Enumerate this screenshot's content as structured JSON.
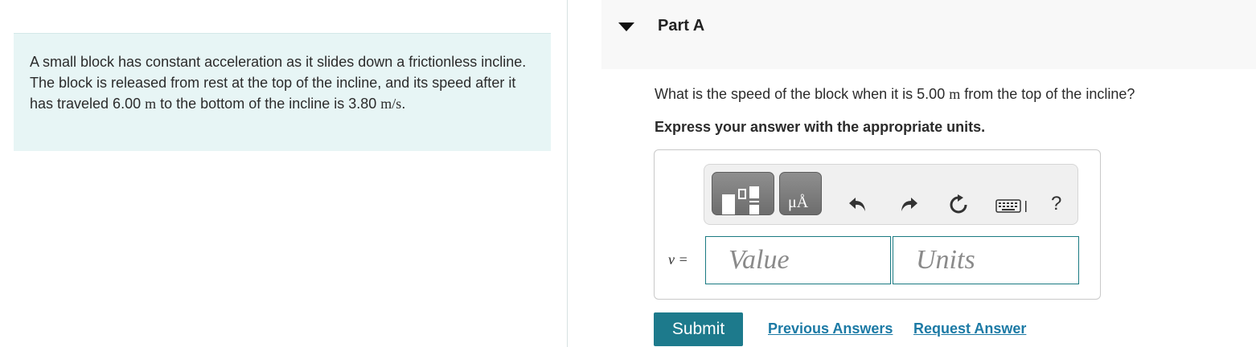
{
  "problem": {
    "text_parts": [
      "A small block has constant acceleration as it slides down a frictionless incline. The block is released from rest at the top of the incline, and its speed after it has traveled 6.00 ",
      "m",
      " to the bottom of the incline is 3.80 ",
      "m/s",
      "."
    ]
  },
  "part": {
    "title": "Part A",
    "question_parts": [
      "What is the speed of the block when it is 5.00 ",
      "m",
      " from the top of the incline?"
    ],
    "instruction": "Express your answer with the appropriate units."
  },
  "toolbar": {
    "icons": [
      "fraction-template-icon",
      "units-template-icon",
      "undo-icon",
      "redo-icon",
      "reset-icon",
      "keyboard-icon",
      "help-icon"
    ],
    "units_glyph": "μÅ",
    "help_label": "?"
  },
  "answer": {
    "variable_label": "v =",
    "value_placeholder": "Value",
    "units_placeholder": "Units"
  },
  "actions": {
    "submit_label": "Submit",
    "previous_answers_label": "Previous Answers",
    "request_answer_label": "Request Answer"
  }
}
